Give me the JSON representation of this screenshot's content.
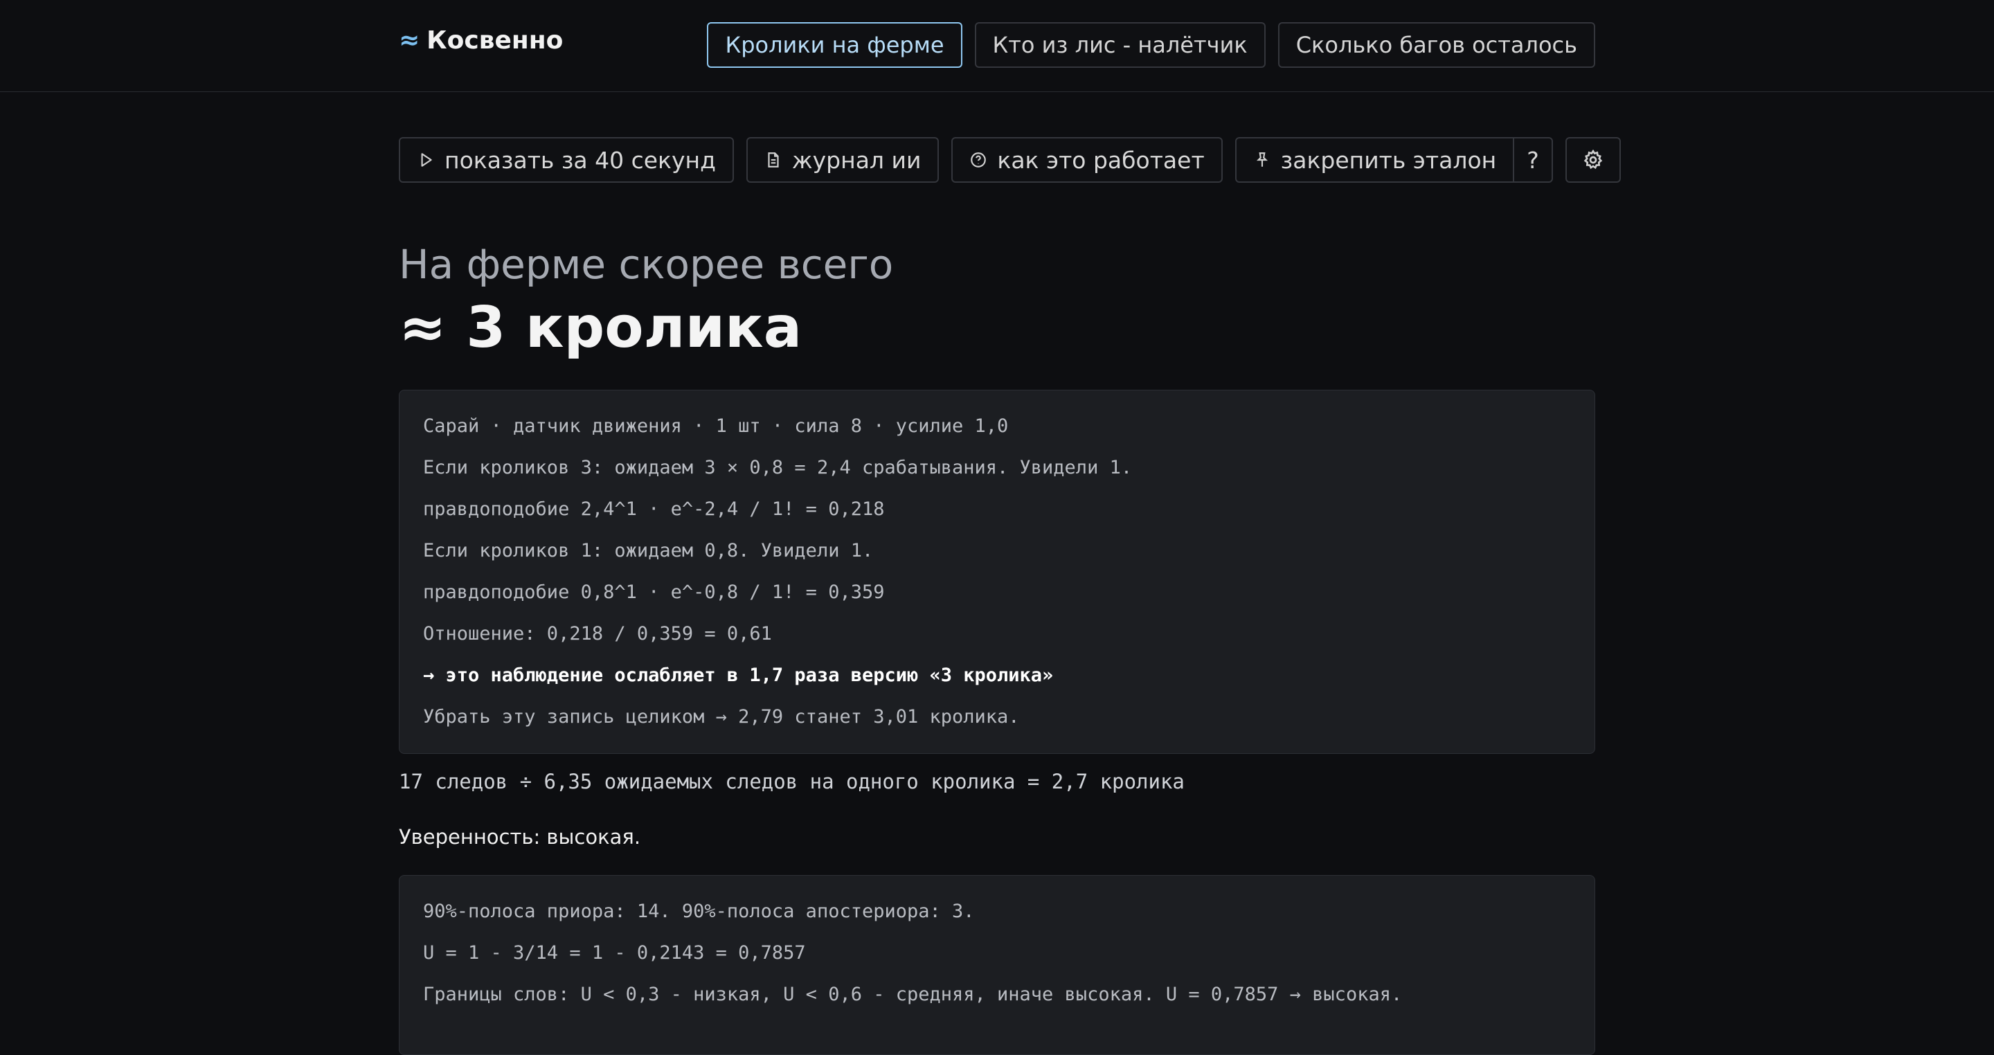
{
  "header": {
    "logo_mark": "≈",
    "logo_text": "Косвенно",
    "tabs": [
      {
        "label": "Кролики на ферме",
        "active": true
      },
      {
        "label": "Кто из лис - налётчик",
        "active": false
      },
      {
        "label": "Сколько багов осталось",
        "active": false
      }
    ]
  },
  "toolbar": {
    "play_label": "показать за 40 секунд",
    "log_label": "журнал ии",
    "how_label": "как это работает",
    "pin_label": "закрепить эталон",
    "help_label": "?",
    "icons": {
      "play": "play-icon",
      "log": "document-icon",
      "how": "help-circle-icon",
      "pin": "pin-icon",
      "settings": "gear-icon"
    }
  },
  "main": {
    "subtitle": "На ферме скорее всего",
    "estimate": "≈ 3 кролика",
    "evidence_lines": [
      "Сарай · датчик движения · 1 шт · сила 8 · усилие 1,0",
      "Если кроликов 3: ожидаем 3 × 0,8 = 2,4 срабатывания. Увидели 1.",
      "правдоподобие 2,4^1 · e^-2,4 / 1! = 0,218",
      "Если кроликов 1: ожидаем 0,8. Увидели 1.",
      "правдоподобие 0,8^1 · e^-0,8 / 1! = 0,359",
      "Отношение: 0,218 / 0,359 = 0,61",
      "→ это наблюдение ослабляет в 1,7 раза версию «3 кролика»",
      "Убрать эту запись целиком → 2,79 станет 3,01 кролика."
    ],
    "tracks_summary": "17 следов ÷ 6,35 ожидаемых следов на одного кролика = 2,7 кролика",
    "confidence": "Уверенность: высокая.",
    "confidence_lines": [
      "90%-полоса приора: 14. 90%-полоса апостериора: 3.",
      "U = 1 - 3/14 = 1 - 0,2143 = 0,7857",
      "Границы слов: U < 0,3 - низкая, U < 0,6 - средняя, иначе высокая. U = 0,7857 → высокая."
    ]
  },
  "colors": {
    "background": "#0d0e11",
    "card": "#1c1e22",
    "accent": "#8fc7f0"
  }
}
